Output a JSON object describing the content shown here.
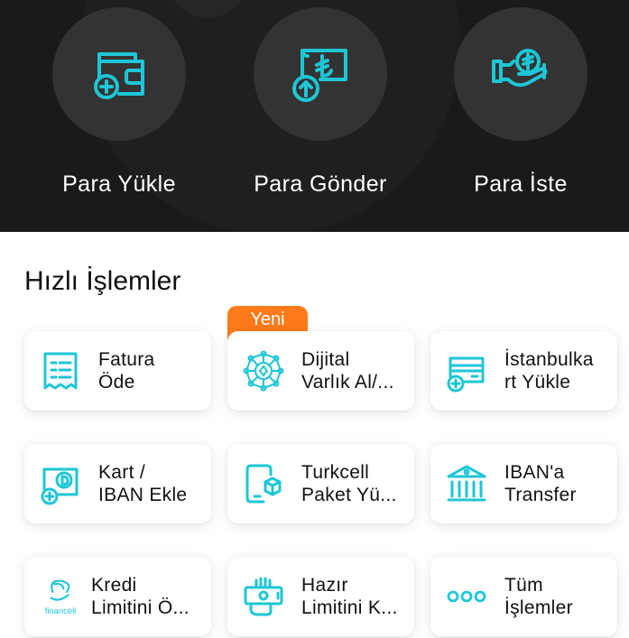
{
  "top_actions": [
    {
      "label": "Para Yükle",
      "icon": "wallet-add-icon"
    },
    {
      "label": "Para Gönder",
      "icon": "lira-send-icon"
    },
    {
      "label": "Para İste",
      "icon": "lira-request-hand-icon"
    }
  ],
  "section_title": "Hızlı İşlemler",
  "badge": "Yeni",
  "quick_actions": [
    {
      "line1": "Fatura",
      "line2": "Öde",
      "icon": "receipt-icon"
    },
    {
      "line1": "Dijital",
      "line2": "Varlık Al/...",
      "icon": "digital-asset-network-icon"
    },
    {
      "line1": "İstanbulka",
      "line2": "rt Yükle",
      "icon": "card-add-icon"
    },
    {
      "line1": "Kart /",
      "line2": "IBAN Ekle",
      "icon": "card-add-payment-icon"
    },
    {
      "line1": "Turkcell",
      "line2": "Paket Yü...",
      "icon": "phone-package-icon"
    },
    {
      "line1": "IBAN'a",
      "line2": "Transfer",
      "icon": "bank-icon"
    },
    {
      "line1": "Kredi",
      "line2": "Limitini Ö...",
      "icon": "financell-logo-icon",
      "logo_text": "financell"
    },
    {
      "line1": "Hazır",
      "line2": "Limitini K...",
      "icon": "hand-money-icon"
    },
    {
      "line1": "Tüm",
      "line2": "İşlemler",
      "icon": "more-dots-icon"
    }
  ],
  "colors": {
    "accent": "#1ec6d6",
    "badge": "#ff7a1a",
    "top_bg": "#1a1a1a",
    "circle_bg": "#333333"
  }
}
